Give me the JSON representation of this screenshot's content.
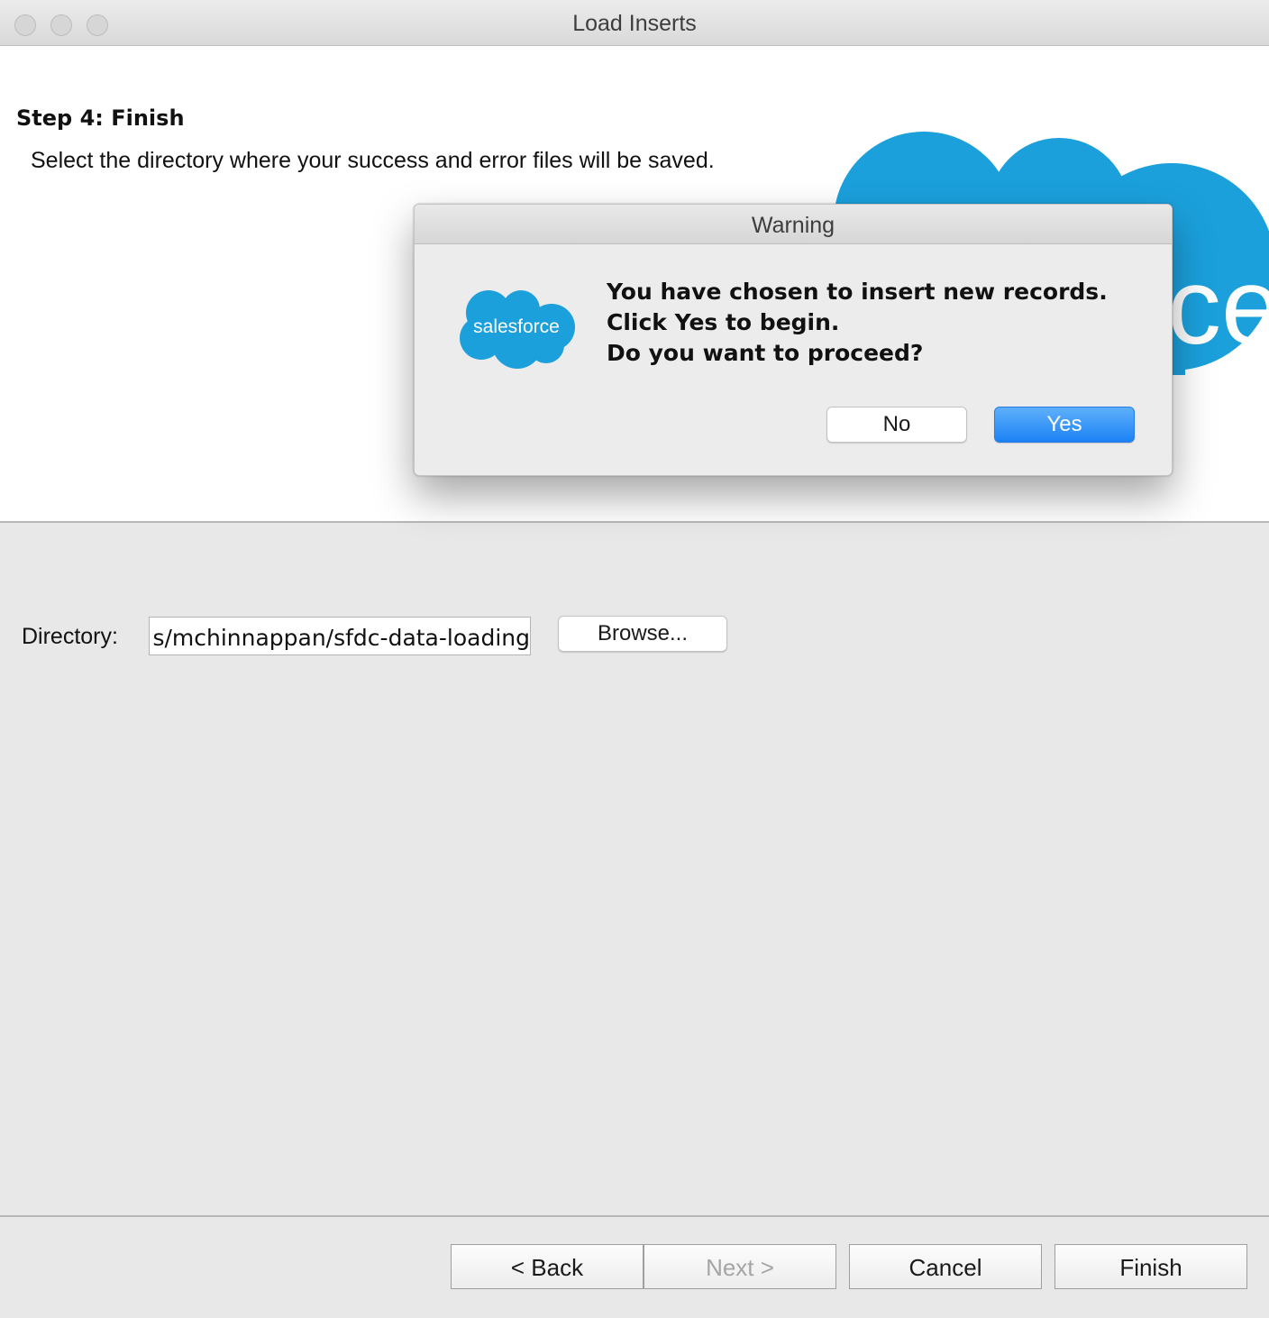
{
  "window": {
    "title": "Load Inserts"
  },
  "header": {
    "step_title": "Step 4: Finish",
    "description": "Select the directory where your success and error files will be saved."
  },
  "directory": {
    "label": "Directory:",
    "value": "s/mchinnappan/sfdc-data-loading",
    "browse_label": "Browse..."
  },
  "footer": {
    "back_label": "< Back",
    "next_label": "Next >",
    "cancel_label": "Cancel",
    "finish_label": "Finish"
  },
  "dialog": {
    "title": "Warning",
    "logo_text": "salesforce",
    "message_lines": [
      "You have chosen to insert new records.",
      "Click Yes to begin.",
      "Do you want to proceed?"
    ],
    "no_label": "No",
    "yes_label": "Yes"
  },
  "colors": {
    "salesforce_blue": "#1ba0dc",
    "yes_button": "#1c82f5"
  },
  "icons": {
    "window_controls": [
      "close-icon",
      "minimize-icon",
      "zoom-icon"
    ],
    "logo": "salesforce-cloud-logo"
  }
}
